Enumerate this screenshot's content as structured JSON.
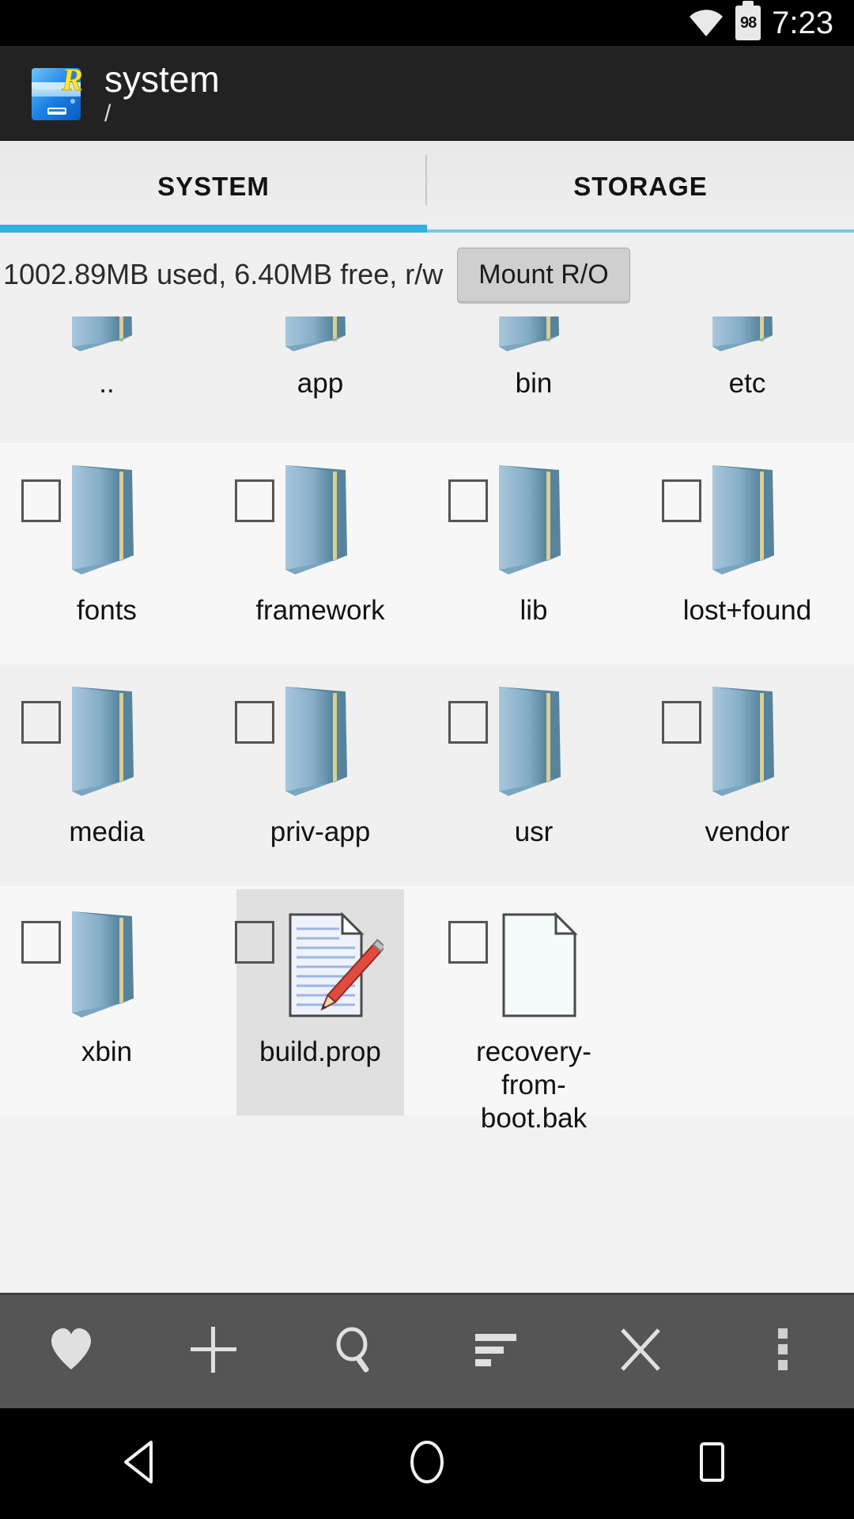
{
  "status_bar": {
    "wifi_icon": "wifi-icon",
    "battery_icon": "battery-icon",
    "battery_level": "98",
    "time": "7:23"
  },
  "app_header": {
    "app_icon": "root-explorer-icon",
    "title": "system",
    "path": "/"
  },
  "tabs": [
    {
      "label": "SYSTEM",
      "active": true
    },
    {
      "label": "STORAGE",
      "active": false
    }
  ],
  "mount_bar": {
    "info": "1002.89MB used, 6.40MB free, r/w",
    "button_label": "Mount R/O"
  },
  "colors": {
    "accent": "#33aede",
    "accent_inactive": "#7cc9e4",
    "appbar_bg": "#222222",
    "tabs_bg": "#ececec",
    "grid_bg": "#f2f2f2",
    "toolbar_bg": "#555555",
    "selected_bg": "#e0e0e0",
    "folder_blue": "#7ea9c4"
  },
  "file_grid": {
    "rows": [
      {
        "band": "band-a",
        "clipped": true,
        "cells": [
          {
            "name": "..",
            "type": "folder",
            "checkbox": false,
            "selected": false
          },
          {
            "name": "app",
            "type": "folder",
            "checkbox": false,
            "selected": false
          },
          {
            "name": "bin",
            "type": "folder",
            "checkbox": false,
            "selected": false
          },
          {
            "name": "etc",
            "type": "folder",
            "checkbox": false,
            "selected": false
          }
        ]
      },
      {
        "band": "band-b",
        "clipped": false,
        "cells": [
          {
            "name": "fonts",
            "type": "folder",
            "checkbox": true,
            "selected": false
          },
          {
            "name": "framework",
            "type": "folder",
            "checkbox": true,
            "selected": false
          },
          {
            "name": "lib",
            "type": "folder",
            "checkbox": true,
            "selected": false
          },
          {
            "name": "lost+found",
            "type": "folder",
            "checkbox": true,
            "selected": false
          }
        ]
      },
      {
        "band": "band-a",
        "clipped": false,
        "cells": [
          {
            "name": "media",
            "type": "folder",
            "checkbox": true,
            "selected": false
          },
          {
            "name": "priv-app",
            "type": "folder",
            "checkbox": true,
            "selected": false
          },
          {
            "name": "usr",
            "type": "folder",
            "checkbox": true,
            "selected": false
          },
          {
            "name": "vendor",
            "type": "folder",
            "checkbox": true,
            "selected": false
          }
        ]
      },
      {
        "band": "band-b",
        "clipped": false,
        "cells": [
          {
            "name": "xbin",
            "type": "folder",
            "checkbox": true,
            "selected": false
          },
          {
            "name": "build.prop",
            "type": "text-file",
            "checkbox": true,
            "selected": true
          },
          {
            "name": "recovery-from-boot.bak",
            "type": "file",
            "checkbox": true,
            "selected": false
          },
          {
            "name": "",
            "type": "empty",
            "checkbox": false,
            "selected": false
          }
        ]
      }
    ]
  },
  "toolbar": {
    "buttons": [
      {
        "icon": "heart-icon",
        "label": "Favorites"
      },
      {
        "icon": "plus-icon",
        "label": "New"
      },
      {
        "icon": "search-icon",
        "label": "Search"
      },
      {
        "icon": "sort-icon",
        "label": "Sort"
      },
      {
        "icon": "close-x-icon",
        "label": "Close"
      },
      {
        "icon": "overflow-dots-icon",
        "label": "More options"
      }
    ]
  },
  "nav_bar": {
    "buttons": [
      {
        "icon": "back-triangle-icon",
        "label": "Back"
      },
      {
        "icon": "home-circle-icon",
        "label": "Home"
      },
      {
        "icon": "recents-square-icon",
        "label": "Recents"
      }
    ]
  }
}
